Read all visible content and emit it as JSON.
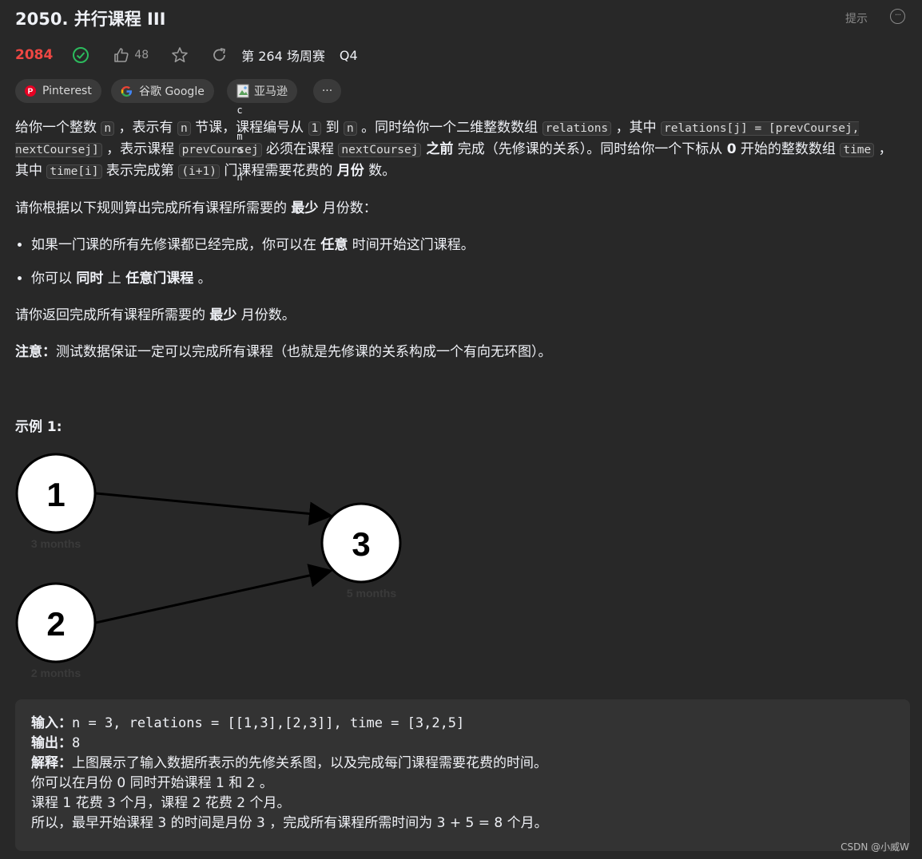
{
  "header": {
    "title": "2050. 并行课程 III",
    "hint_label": "提示",
    "more_icon": "more-icon"
  },
  "meta": {
    "problem_id": "2084",
    "likes": "48",
    "contest": "第 264 场周赛",
    "quarter": "Q4"
  },
  "tags": [
    {
      "label": "Pinterest",
      "icon": "pinterest-icon"
    },
    {
      "label": "谷歌 Google",
      "icon": "google-icon"
    },
    {
      "label": "亚马逊",
      "icon": "amazon-image-icon"
    },
    {
      "label": "···",
      "icon": "more-tags-icon"
    }
  ],
  "overlay_glyphs": [
    "c",
    "m",
    "o",
    "n"
  ],
  "description": {
    "p1": {
      "t1": "给你一个整数 ",
      "c1": "n",
      "t2": " ，表示有 ",
      "c2": "n",
      "t3": " 节课，课程编号从 ",
      "c3": "1",
      "t4": " 到 ",
      "c4": "n",
      "t5": " 。同时给你一个二维整数数组 ",
      "c5": "relations",
      "t6": " ，其中 ",
      "c6": "relations[j] = [prevCoursej, nextCoursej]",
      "t7": " ，表示课程 ",
      "c7": "prevCoursej",
      "t8": " 必须在课程 ",
      "c8": "nextCoursej",
      "b1": " 之前",
      "t9": " 完成（先修课的关系）。同时给你一个下标从 ",
      "b2": "0",
      "t10": " 开始的整数数组 ",
      "c9": "time",
      "t11": " ，其中 ",
      "c10": "time[i]",
      "t12": " 表示完成第 ",
      "c11": "(i+1)",
      "t13": " 门课程需要花费的 ",
      "b3": "月份",
      "t14": " 数。"
    },
    "p2": {
      "t1": "请你根据以下规则算出完成所有课程所需要的 ",
      "b1": "最少",
      "t2": " 月份数："
    },
    "rule1": {
      "t1": "如果一门课的所有先修课都已经完成，你可以在 ",
      "b1": "任意",
      "t2": " 时间开始这门课程。"
    },
    "rule2": {
      "t1": "你可以 ",
      "b1": "同时",
      "t2": " 上 ",
      "b2": "任意门课程",
      "t3": " 。"
    },
    "p3": {
      "t1": "请你返回完成所有课程所需要的 ",
      "b1": "最少",
      "t2": " 月份数。"
    },
    "p4": {
      "b1": "注意：",
      "t1": "测试数据保证一定可以完成所有课程（也就是先修课的关系构成一个有向无环图）。"
    }
  },
  "example": {
    "heading": "示例 1:",
    "graph": {
      "nodes": [
        {
          "id": "1",
          "label": "3 months"
        },
        {
          "id": "2",
          "label": "2 months"
        },
        {
          "id": "3",
          "label": "5 months"
        }
      ],
      "edges": [
        [
          "1",
          "3"
        ],
        [
          "2",
          "3"
        ]
      ]
    },
    "input_label": "输入：",
    "input_value": "n = 3, relations = [[1,3],[2,3]], time = [3,2,5]",
    "output_label": "输出：",
    "output_value": "8",
    "explain_label": "解释：",
    "explain_lines": [
      "上图展示了输入数据所表示的先修关系图，以及完成每门课程需要花费的时间。",
      "你可以在月份 0 同时开始课程 1 和 2 。",
      "课程 1 花费 3 个月，课程 2 花费 2 个月。",
      "所以，最早开始课程 3 的时间是月份 3 ，完成所有课程所需时间为 3 + 5 = 8 个月。"
    ]
  },
  "watermark": "CSDN @小威W"
}
